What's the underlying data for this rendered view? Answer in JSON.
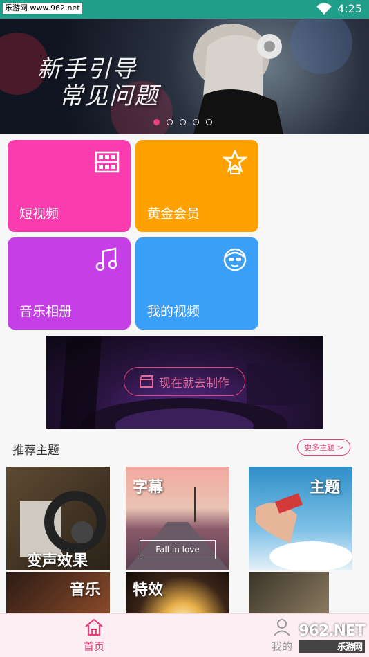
{
  "status_bar": {
    "watermark": "乐游网 www.962.net",
    "time": "4:25"
  },
  "banner": {
    "line1": "新手引导",
    "line2": "常见问题",
    "active_dot": 0,
    "dot_count": 5
  },
  "tiles": [
    {
      "label": "短视频",
      "color": "#fb3cae",
      "icon": "film-icon"
    },
    {
      "label": "黄金会员",
      "color": "#ffa100",
      "icon": "star-badge-icon"
    },
    {
      "label": "音乐相册",
      "color": "#c53ee6",
      "icon": "music-note-icon"
    },
    {
      "label": "我的视频",
      "color": "#3a9ff8",
      "icon": "user-avatar-icon"
    }
  ],
  "promo": {
    "button_label": "现在就去制作",
    "icon": "clapper-icon"
  },
  "section": {
    "title": "推荐主题",
    "more_label": "更多主题 >"
  },
  "themes": [
    {
      "label": "变声效果"
    },
    {
      "label": "字幕",
      "sub": "Fall in love"
    },
    {
      "label": "主题"
    },
    {
      "label": "音乐"
    },
    {
      "label": "特效"
    },
    {
      "label": ""
    }
  ],
  "bottom_nav": {
    "home_label": "首页",
    "me_label": "我的"
  },
  "corner_watermark": {
    "main": "962.NET",
    "sub": "乐游网"
  },
  "colors": {
    "accent": "#e8427b",
    "status_bar": "#1f9e8a"
  }
}
